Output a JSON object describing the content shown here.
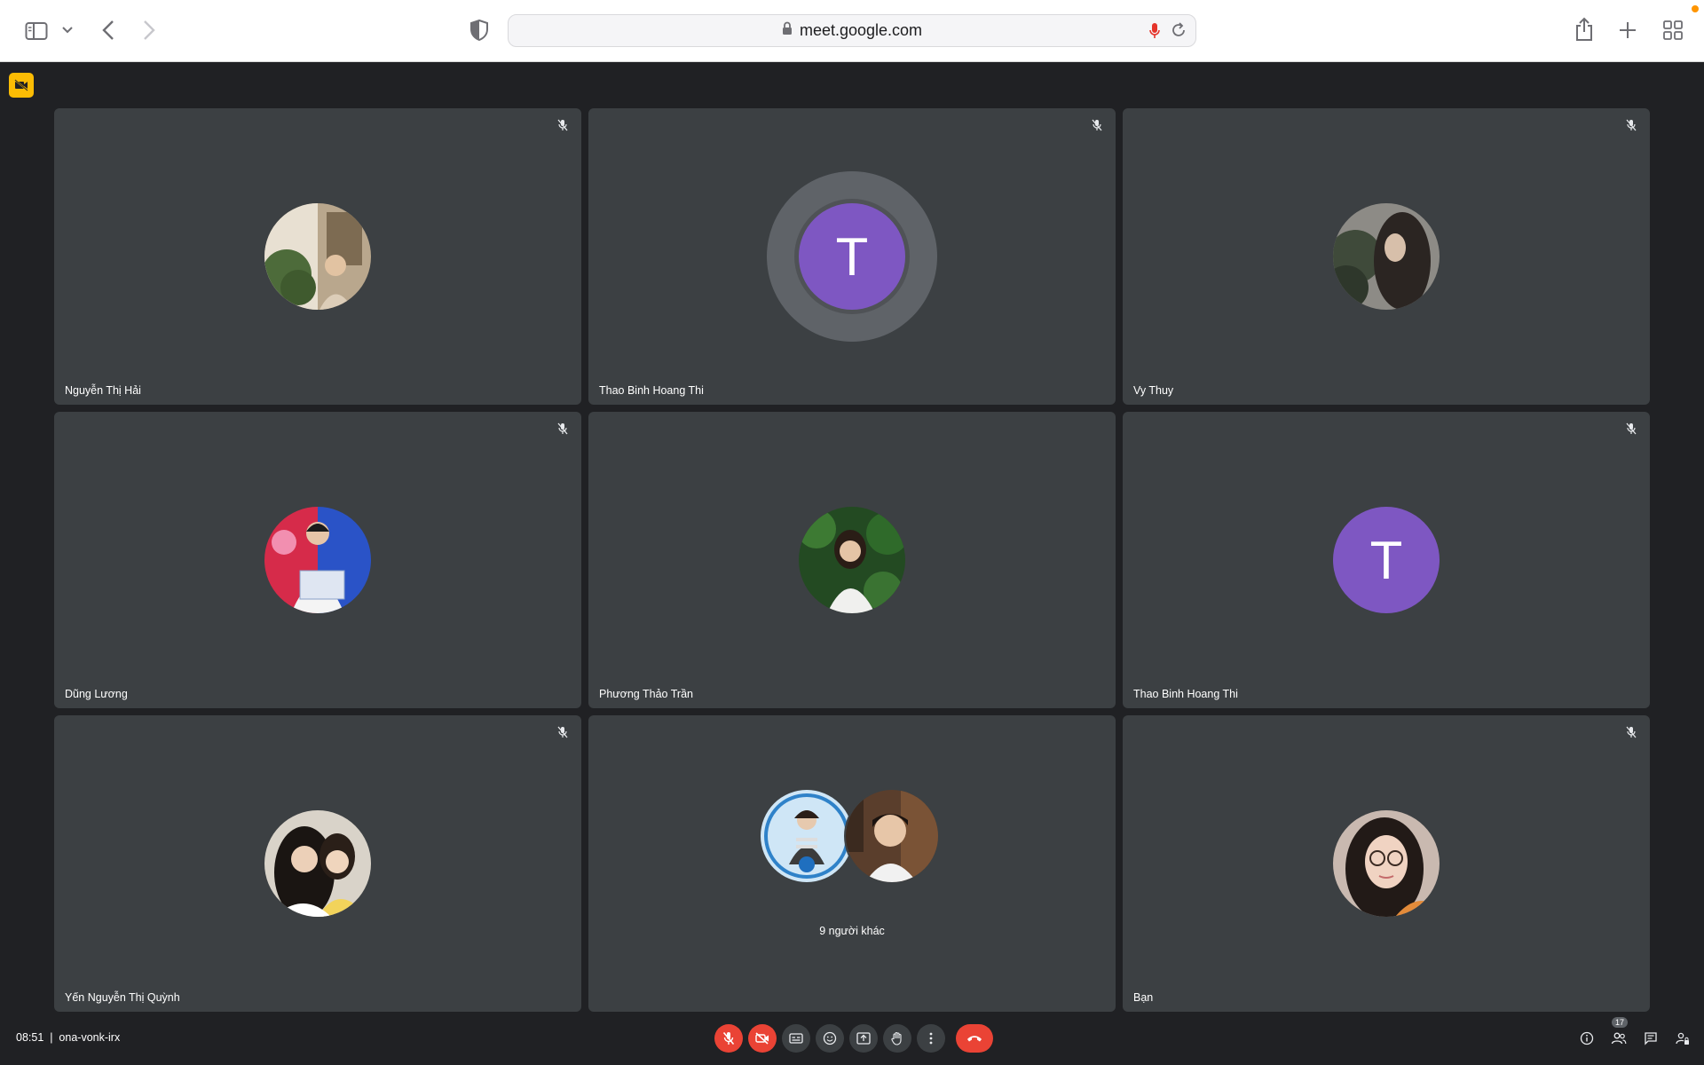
{
  "browser": {
    "url": "meet.google.com"
  },
  "tiles": [
    {
      "name": "Nguyễn Thị Hải",
      "avatar": "photo"
    },
    {
      "name": "Thao Binh Hoang Thi",
      "avatar": "letter",
      "letter": "T",
      "speaking": true
    },
    {
      "name": "Vy Thuy",
      "avatar": "photo"
    },
    {
      "name": "Dũng Lương",
      "avatar": "photo"
    },
    {
      "name": "Phương Thảo Trần",
      "avatar": "photo"
    },
    {
      "name": "Thao Binh Hoang Thi",
      "avatar": "letter",
      "letter": "T"
    },
    {
      "name": "Yến Nguyễn Thị Quỳnh",
      "avatar": "photo"
    },
    {
      "others_label": "9 người khác"
    },
    {
      "name": "Bạn",
      "avatar": "photo"
    }
  ],
  "bottom_bar": {
    "meeting_info": "08:51  |  ona-vonk-irx",
    "participant_count": "17"
  },
  "colors": {
    "background": "#202124",
    "tile": "#3c4043",
    "avatar_purple": "#7e57c2",
    "danger": "#ea4335",
    "warning_badge": "#fbbc04"
  }
}
